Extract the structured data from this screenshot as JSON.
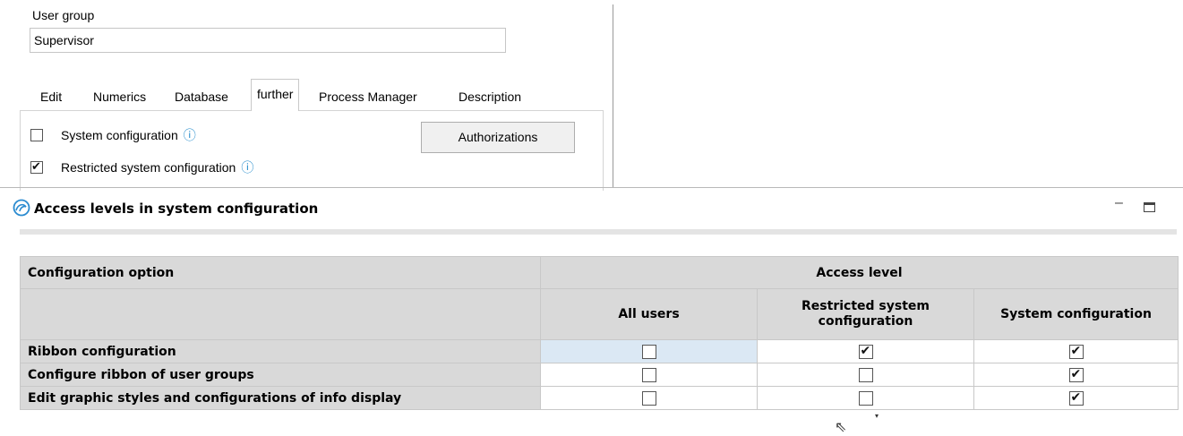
{
  "form": {
    "user_group_label": "User group",
    "user_group_value": "Supervisor",
    "tabs": [
      "Edit",
      "Numerics",
      "Database",
      "further",
      "Process Manager",
      "Description"
    ],
    "active_tab": "further",
    "options": [
      {
        "label": "System configuration",
        "checked": false
      },
      {
        "label": "Restricted system configuration",
        "checked": true
      }
    ],
    "authorizations_label": "Authorizations"
  },
  "window": {
    "title": "Access levels in system configuration",
    "minimize_glyph": "–",
    "icon": "app-swirl-icon"
  },
  "table": {
    "col_option": "Configuration option",
    "col_group": "Access level",
    "levels": [
      "All users",
      "Restricted system configuration",
      "System configuration"
    ],
    "rows": [
      {
        "label": "Ribbon configuration",
        "values": [
          false,
          true,
          true
        ]
      },
      {
        "label": "Configure ribbon of user groups",
        "values": [
          false,
          false,
          true
        ]
      },
      {
        "label": "Edit graphic styles and configurations of info display",
        "values": [
          false,
          false,
          true
        ]
      }
    ]
  },
  "colors": {
    "header_bg": "#d9d9d9",
    "selected_cell": "#dbe8f4",
    "info_icon": "#1a86c9"
  }
}
